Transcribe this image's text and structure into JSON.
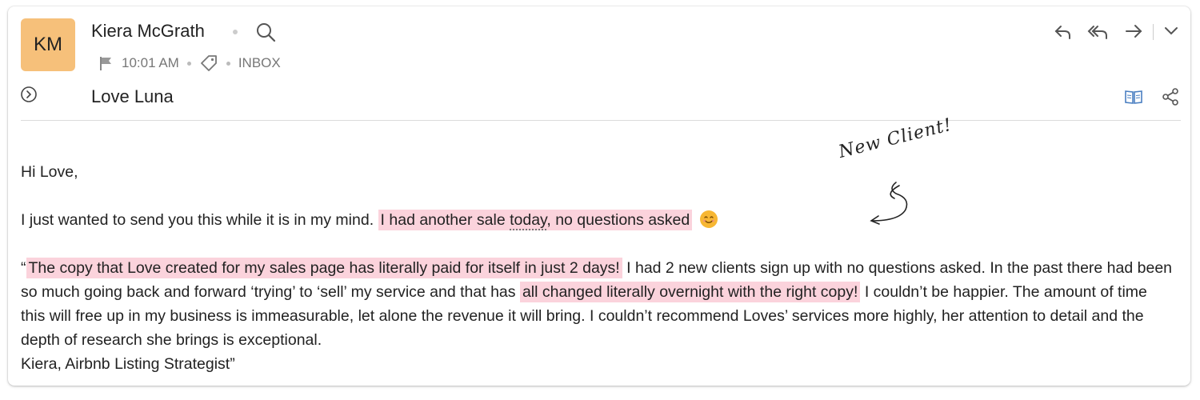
{
  "header": {
    "avatar_initials": "KM",
    "sender_name": "Kiera McGrath",
    "time": "10:01 AM",
    "folder": "INBOX",
    "subject": "Love Luna"
  },
  "icons": {
    "search": "search-icon",
    "flag": "flag-icon",
    "tag": "tag-icon",
    "reply": "reply-icon",
    "reply_all": "reply-all-icon",
    "forward": "forward-icon",
    "more": "chevron-down-icon",
    "expand": "expand-circle-icon",
    "reader": "book-icon",
    "share": "share-icon"
  },
  "body": {
    "greeting": "Hi Love,",
    "p1_plain": "I just wanted to send you this while it is in my mind.",
    "p1_hl_a": "I had another sale ",
    "p1_hl_dotted": "today",
    "p1_hl_b": ", no questions asked",
    "q_open": "“",
    "q_hl1": "The copy that Love created for my sales page has literally paid for itself in just 2 days!",
    "q_t1": " I had 2 new clients sign up with no questions asked.  In the past there had been so much going back and forward ‘trying’ to ‘sell’ my service and that has ",
    "q_hl2": "all changed literally overnight with the right copy!",
    "q_t2": " I couldn’t be happier.  The amount of time this will free up in my business is immeasurable, let alone the revenue it will bring.  I couldn’t recommend Loves’ services more highly, her attention to detail and the depth of research she brings is exceptional.",
    "signature": "Kiera, Airbnb Listing Strategist”"
  },
  "annotation": {
    "text": "New Client!"
  },
  "colors": {
    "avatar": "#f6c07a",
    "highlight": "#fbd3dc",
    "accent_icon": "#4a7fc1",
    "emoji": "#f7b733"
  }
}
